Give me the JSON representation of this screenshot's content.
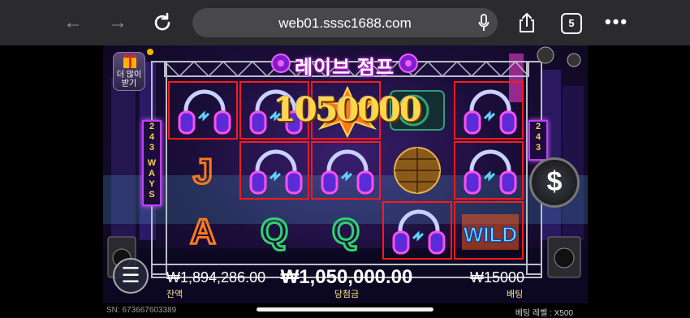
{
  "browser": {
    "url": "web01.sssc1688.com",
    "tab_count": "5",
    "icons": [
      "back-icon",
      "forward-icon",
      "reload-icon",
      "mic-icon",
      "share-icon",
      "tabs-icon",
      "more-icon"
    ]
  },
  "game": {
    "title": "레이브 점프",
    "more_button_label": "더 많이 받기",
    "ways_left": [
      "2",
      "4",
      "3",
      "W",
      "A",
      "Y",
      "S"
    ],
    "ways_right": [
      "2",
      "4",
      "3"
    ],
    "win_amount": "1050000",
    "coin_symbol": "$",
    "menu_symbol": "☰",
    "balance_value": "₩1,894,286.00",
    "balance_label": "잔액",
    "winnings_value": "₩1,050,000.00",
    "winnings_label": "당첨금",
    "bet_value": "₩15000",
    "bet_label": "배팅",
    "serial": "SN:  673667603389",
    "bet_level": "베팅 레벨  :  X500",
    "reels": [
      [
        "headphones",
        "J",
        "A"
      ],
      [
        "headphones",
        "headphones",
        "Q"
      ],
      [
        "starburst",
        "headphones",
        "Q"
      ],
      [
        "turntable",
        "disco-ball",
        "headphones"
      ],
      [
        "headphones",
        "headphones",
        "wild"
      ]
    ],
    "win_highlights": [
      [
        0,
        0
      ],
      [
        1,
        0
      ],
      [
        1,
        1
      ],
      [
        2,
        0
      ],
      [
        2,
        1
      ],
      [
        3,
        2
      ],
      [
        4,
        0
      ],
      [
        4,
        1
      ],
      [
        4,
        2
      ]
    ],
    "colors": {
      "win_border": "#ff1a1a",
      "accent_gold": "#ffd84a",
      "neon_purple": "#c040ff"
    }
  }
}
